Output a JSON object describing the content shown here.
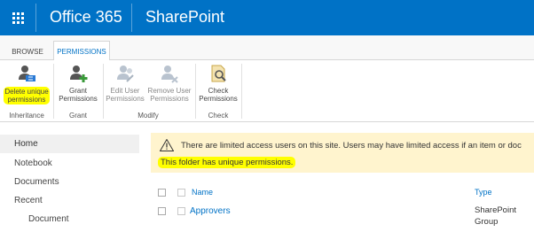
{
  "suite": {
    "office": "Office 365",
    "app": "SharePoint"
  },
  "ribbon": {
    "tabs": [
      "BROWSE",
      "PERMISSIONS"
    ],
    "buttons": {
      "delete_unique": [
        "Delete unique",
        "permissions"
      ],
      "grant": [
        "Grant",
        "Permissions"
      ],
      "edit_user": [
        "Edit User",
        "Permissions"
      ],
      "remove_user": [
        "Remove User",
        "Permissions"
      ],
      "check": [
        "Check",
        "Permissions"
      ]
    },
    "groups": {
      "inheritance": "Inheritance",
      "grant": "Grant",
      "modify": "Modify",
      "check": "Check"
    }
  },
  "nav": {
    "items": [
      "Home",
      "Notebook",
      "Documents",
      "Recent",
      "Document"
    ]
  },
  "banner": {
    "message": "There are limited access users on this site. Users may have limited access if an item or doc",
    "unique": "This folder has unique permissions."
  },
  "list": {
    "columns": {
      "name": "Name",
      "type": "Type"
    },
    "rows": [
      {
        "name": "Approvers",
        "type_line1": "SharePoint",
        "type_line2": "Group"
      }
    ]
  },
  "colors": {
    "suite_bar": "#0072c6",
    "highlight": "#ffff00",
    "banner_bg": "#fff4ce",
    "link": "#0072c6"
  }
}
